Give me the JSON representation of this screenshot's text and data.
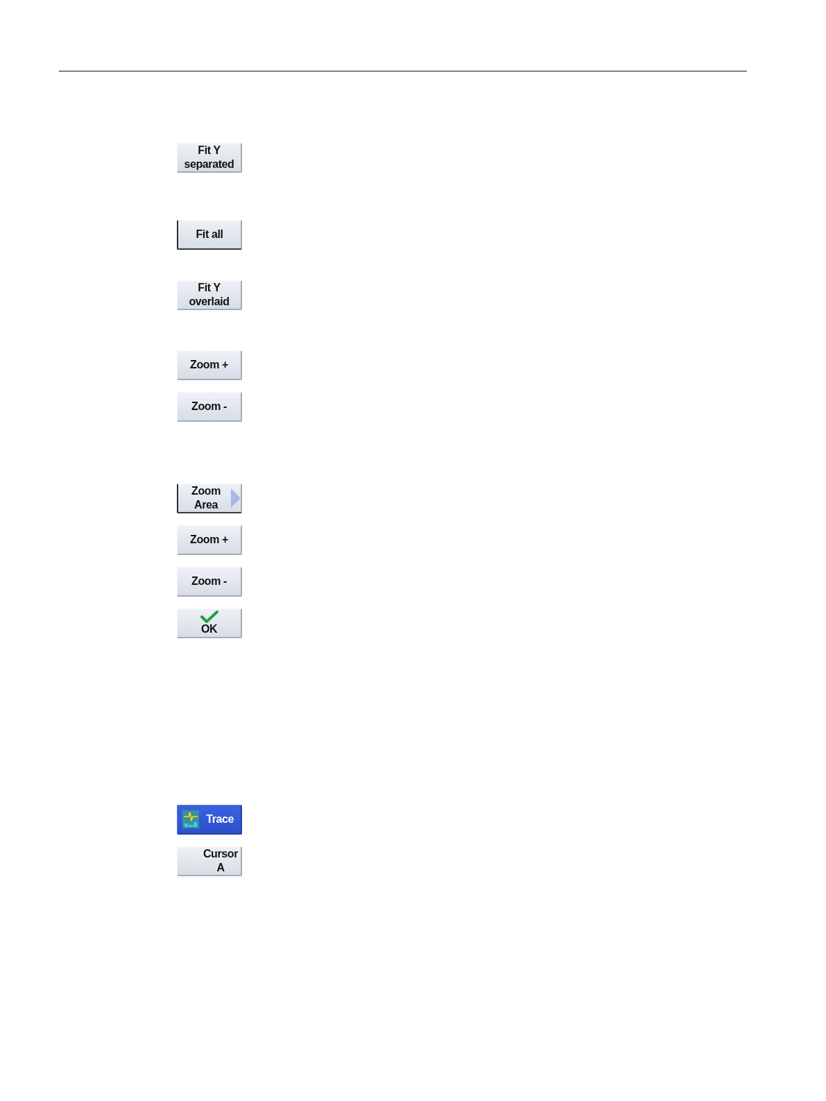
{
  "softkey_groups": [
    {
      "buttons": [
        {
          "label": "Fit Y\nseparated",
          "kind": "plain",
          "pressed": false,
          "selected": false
        }
      ]
    },
    {
      "buttons": [
        {
          "label": "Fit all",
          "kind": "plain",
          "pressed": true,
          "selected": false
        }
      ]
    },
    {
      "buttons": [
        {
          "label": "Fit Y\noverlaid",
          "kind": "plain",
          "pressed": false,
          "selected": false
        }
      ]
    },
    {
      "buttons": [
        {
          "label": "Zoom +",
          "kind": "plain",
          "pressed": false,
          "selected": false
        },
        {
          "label": "Zoom -",
          "kind": "plain",
          "pressed": false,
          "selected": false
        }
      ]
    },
    {
      "buttons": [
        {
          "label": "Zoom\nArea",
          "kind": "submenu",
          "pressed": true,
          "selected": false
        },
        {
          "label": "Zoom +",
          "kind": "plain",
          "pressed": false,
          "selected": false
        },
        {
          "label": "Zoom -",
          "kind": "plain",
          "pressed": false,
          "selected": false
        },
        {
          "label": "OK",
          "kind": "ok",
          "pressed": false,
          "selected": false
        }
      ]
    },
    {
      "buttons": [
        {
          "label": "Trace",
          "kind": "icon",
          "pressed": false,
          "selected": true
        },
        {
          "label": "Cursor\nA",
          "kind": "iconslot",
          "pressed": false,
          "selected": false
        }
      ]
    }
  ]
}
